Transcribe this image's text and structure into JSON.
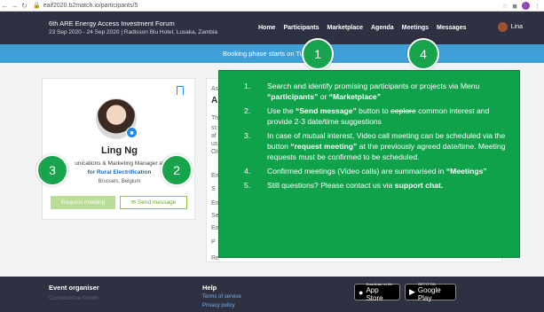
{
  "browser": {
    "url": "eaif2020.b2match.io/participants/5",
    "back_glyph": "←",
    "forward_glyph": "→",
    "reload_glyph": "↻",
    "lock_glyph": "🔒",
    "profile_initial": "L"
  },
  "header": {
    "title": "6th ARE Energy Access Investment Forum",
    "subtitle": "23 Sep 2020 - 24 Sep 2020 | Radisson Blu Hotel, Lusaka, Zambia",
    "nav": [
      "Home",
      "Participants",
      "Marketplace",
      "Agenda",
      "Meetings",
      "Messages"
    ],
    "user_name": "Lina"
  },
  "banner": {
    "text": "Booking phase starts on Tuesday"
  },
  "profile": {
    "name": "Ling Ng",
    "role": "unications & Marketing Manager at",
    "org": "for Rural Electrification",
    "location": "Brussels, Belgium",
    "request_button": "Request meeting",
    "message_button": "Send message",
    "message_icon_glyph": "✉"
  },
  "panel": {
    "fragments": [
      "As",
      "A",
      "Th",
      "sc",
      "af",
      "us",
      "Ot",
      "En",
      "S",
      "En",
      "Se",
      "En",
      "P",
      "Re"
    ]
  },
  "instructions": {
    "items": [
      {
        "num": "1.",
        "parts": [
          {
            "t": "Search and identify promising participants or projects via Menu "
          },
          {
            "t": "“participants”",
            "b": true
          },
          {
            "t": " or "
          },
          {
            "t": "“Marketplace”",
            "b": true
          }
        ]
      },
      {
        "num": "2.",
        "parts": [
          {
            "t": "Use the "
          },
          {
            "t": "“Send message”",
            "b": true
          },
          {
            "t": " button to "
          },
          {
            "t": "eeplore",
            "s": true
          },
          {
            "t": " common interest and provide 2-3 date/time suggestions"
          }
        ]
      },
      {
        "num": "3.",
        "parts": [
          {
            "t": "In case of mutual interest, Video call meeting can be scheduled via the button "
          },
          {
            "t": "“request meeting”",
            "b": true
          },
          {
            "t": " at the previously agreed date/time. Meeting requests must be confirmed to be scheduled."
          }
        ]
      },
      {
        "num": "4.",
        "parts": [
          {
            "t": "Confirmed meetings (Video calls) are summarised in "
          },
          {
            "t": "“Meetings”",
            "b": true
          }
        ]
      },
      {
        "num": "5.",
        "parts": [
          {
            "t": "Still questions? Please contact us via "
          },
          {
            "t": "support chat.",
            "b": true
          }
        ]
      }
    ]
  },
  "callouts": [
    "1",
    "4",
    "3",
    "2"
  ],
  "footer": {
    "organiser_heading": "Event organiser",
    "organiser_name": "Constructive Gmbh",
    "help_heading": "Help",
    "help_links": [
      "Terms of service",
      "Privacy policy"
    ],
    "appstore_small": "Download on the",
    "appstore_big": "App Store",
    "googleplay_small": "GET IT ON",
    "googleplay_big": "Google Play"
  },
  "colors": {
    "header_bg": "#2d3142",
    "banner_bg": "#3fa0d8",
    "overlay_green": "#0fa24a",
    "callout_green": "#18a44c"
  }
}
